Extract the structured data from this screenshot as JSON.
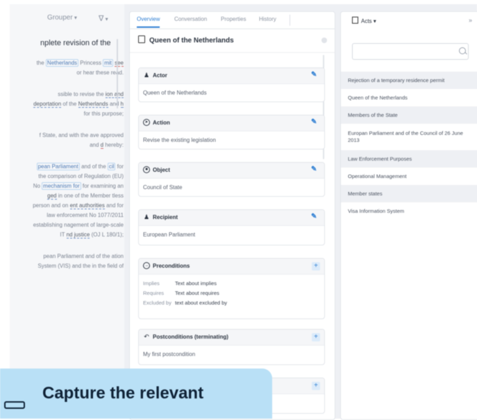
{
  "left": {
    "toolbar": {
      "group_label": "Grouper",
      "filter_label": ""
    },
    "title": "nplete revision of the",
    "paragraphs": [
      [
        "the ",
        {
          "t": "Netherlands",
          "s": "hl"
        },
        " Princess ",
        {
          "t": "mit",
          "s": "hl"
        },
        " ",
        {
          "t": "see",
          "s": "ulr"
        },
        " or hear these read."
      ],
      [
        "ssible to revise the ",
        {
          "t": "ion and deportation",
          "s": "ul"
        },
        " of the ",
        {
          "t": "Netherlands",
          "s": "ul"
        },
        " and ",
        {
          "t": "h",
          "s": "ul"
        },
        " for this purpose;"
      ],
      [
        "f State, and with the ",
        "ave approved and ",
        {
          "t": "d",
          "s": "ulr"
        },
        " hereby:"
      ],
      [
        {
          "t": "pean Parliament",
          "s": "hl"
        },
        " and of the ",
        {
          "t": "cil",
          "s": "hl"
        },
        " for the comparison ",
        "of Regulation (EU) No ",
        {
          "t": "mechanism for",
          "s": "hl"
        },
        " for examining an ",
        {
          "t": "ged",
          "s": "ul"
        },
        " in one of the Member ",
        "tless person and on ",
        {
          "t": "ent authorities",
          "s": "ul"
        },
        " and ",
        "for law enforcement ",
        "No 1077/2011 establishing ",
        "nagement of large-scale IT ",
        {
          "t": "nd justice",
          "s": "ul"
        },
        " (OJ L 180/1);"
      ],
      [
        "pean Parliament and of the ",
        "ation System (VIS) and the ",
        "in the field of"
      ]
    ]
  },
  "middle": {
    "tabs": [
      "Overview",
      "Conversation",
      "Properties",
      "History"
    ],
    "header": "Queen of the Netherlands",
    "cards": [
      {
        "title": "Actor",
        "icon": "person-icon",
        "value": "Queen of the Netherlands",
        "action": "edit"
      },
      {
        "title": "Action",
        "icon": "action-icon",
        "value": "Revise the existing legislation",
        "action": "edit"
      },
      {
        "title": "Object",
        "icon": "object-icon",
        "value": "Council of State",
        "action": "edit"
      },
      {
        "title": "Recipient",
        "icon": "recipient-icon",
        "value": "European Parliament",
        "action": "edit"
      },
      {
        "title": "Preconditions",
        "icon": "precondition-icon",
        "action": "add",
        "rows": [
          {
            "k": "Implies",
            "v": "Text about implies"
          },
          {
            "k": "Requires",
            "v": "Text about requires"
          },
          {
            "k": "Excluded by",
            "v": "text about excluded by"
          }
        ]
      },
      {
        "title": "Postconditions (terminating)",
        "icon": "postcondition-icon",
        "value": "My first postcondition",
        "action": "add"
      }
    ]
  },
  "right": {
    "header": "Acts",
    "search": {
      "value": "",
      "placeholder": ""
    },
    "items": [
      "Rejection of a temporary residence permit",
      "Queen of the Netherlands",
      "Members of the State",
      "Europan Parliament and of the Council of 26 June 2013",
      "Law Enforcement Purposes",
      "Operational Management",
      "Member states",
      "Visa Information System"
    ]
  },
  "caption": {
    "text": "Capture the relevant"
  }
}
